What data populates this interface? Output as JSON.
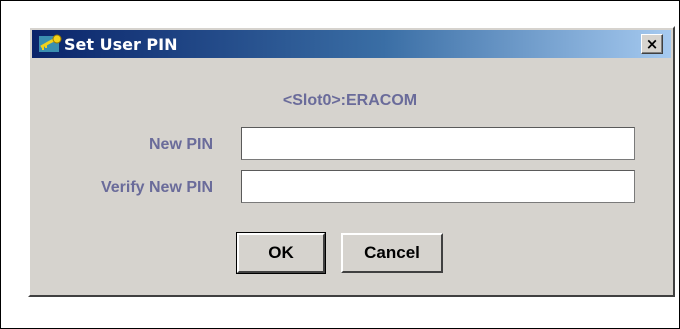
{
  "dialog": {
    "title": "Set User PIN",
    "icon": "key-pin-icon",
    "close_label": "×",
    "slot_label": "<Slot0>:ERACOM",
    "new_pin_label": "New PIN",
    "new_pin_value": "",
    "verify_pin_label": "Verify New PIN",
    "verify_pin_value": "",
    "ok_label": "OK",
    "cancel_label": "Cancel"
  },
  "colors": {
    "title_start": "#0a246a",
    "title_end": "#a6caf0",
    "label_text": "#6a6b9a",
    "dialog_bg": "#d6d3ce"
  }
}
